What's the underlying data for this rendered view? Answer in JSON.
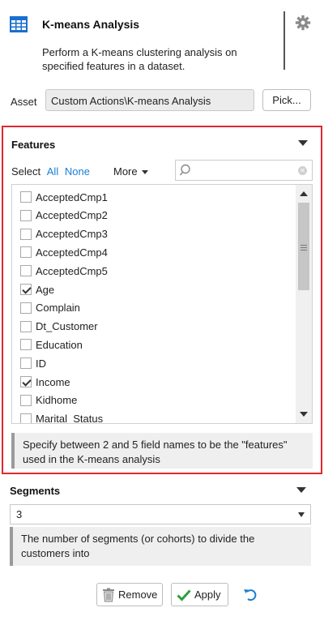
{
  "header": {
    "title": "K-means Analysis",
    "description": "Perform a K-means clustering analysis on specified features in a dataset.",
    "app_icon": "table-grid-icon",
    "settings_icon": "gear-icon"
  },
  "asset": {
    "label": "Asset",
    "value": "Custom Actions\\K-means Analysis",
    "pick_label": "Pick..."
  },
  "features": {
    "title": "Features",
    "select_label": "Select",
    "all_label": "All",
    "none_label": "None",
    "more_label": "More",
    "search_placeholder": "",
    "items": [
      {
        "label": "AcceptedCmp1",
        "checked": false
      },
      {
        "label": "AcceptedCmp2",
        "checked": false
      },
      {
        "label": "AcceptedCmp3",
        "checked": false
      },
      {
        "label": "AcceptedCmp4",
        "checked": false
      },
      {
        "label": "AcceptedCmp5",
        "checked": false
      },
      {
        "label": "Age",
        "checked": true
      },
      {
        "label": "Complain",
        "checked": false
      },
      {
        "label": "Dt_Customer",
        "checked": false
      },
      {
        "label": "Education",
        "checked": false
      },
      {
        "label": "ID",
        "checked": false
      },
      {
        "label": "Income",
        "checked": true
      },
      {
        "label": "Kidhome",
        "checked": false
      },
      {
        "label": "Marital_Status",
        "checked": false
      }
    ],
    "note": "Specify between 2 and 5 field names to be the \"features\" used in the K-means analysis"
  },
  "segments": {
    "title": "Segments",
    "value": "3",
    "note": "The number of segments (or cohorts) to divide the customers into"
  },
  "actions": {
    "remove_label": "Remove",
    "apply_label": "Apply"
  },
  "colors": {
    "accent_link": "#1a7fd4",
    "highlight_border": "#e0282d",
    "apply_check": "#2e9e3e",
    "undo": "#1a7fd4",
    "app_icon": "#1a6fd0"
  }
}
